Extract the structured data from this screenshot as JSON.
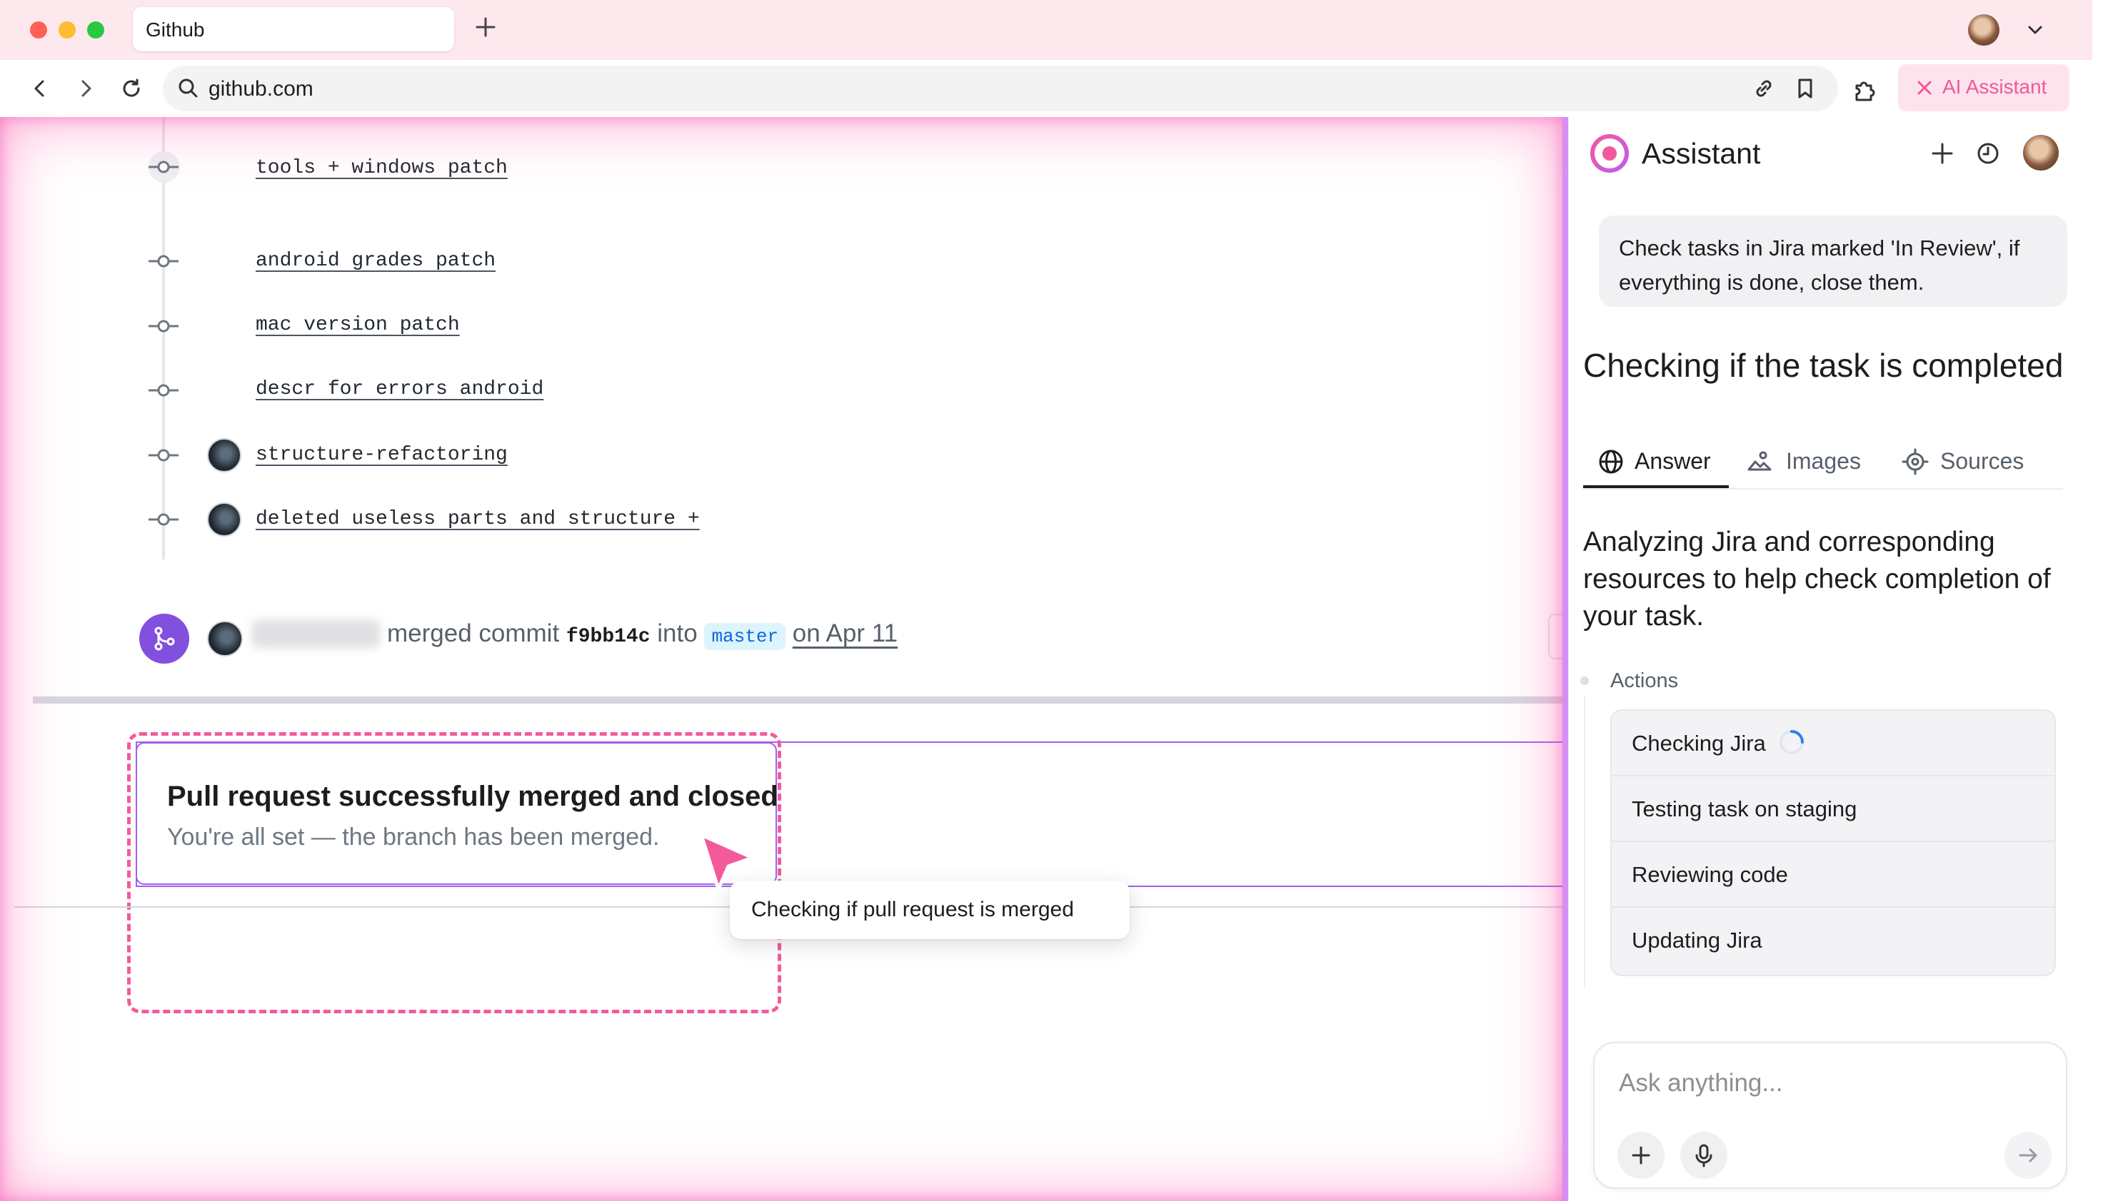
{
  "browser": {
    "tab_title": "Github",
    "url": "github.com",
    "ai_button_label": "AI Assistant"
  },
  "commits": [
    {
      "label": "tools + windows patch",
      "has_avatar": false
    },
    {
      "label": "android grades patch",
      "has_avatar": false
    },
    {
      "label": "mac version patch",
      "has_avatar": false
    },
    {
      "label": "descr for errors android",
      "has_avatar": false
    },
    {
      "label": "structure-refactoring",
      "has_avatar": true
    },
    {
      "label": "deleted useless parts and structure +",
      "has_avatar": true
    }
  ],
  "merge_event": {
    "text_merged": "merged commit",
    "sha": "f9bb14c",
    "text_into": "into",
    "branch": "master",
    "date": "on Apr 11"
  },
  "status_card": {
    "title": "Pull request successfully merged and closed",
    "subtitle": "You're all set — the branch has been merged."
  },
  "tooltip": {
    "text": "Checking if pull request is merged"
  },
  "assistant": {
    "title": "Assistant",
    "prompt": "Check  tasks in Jira marked 'In Review', if everything is done, close them.",
    "heading": "Checking if the task is completed",
    "tabs": [
      {
        "label": "Answer",
        "icon": "globe-icon",
        "active": true
      },
      {
        "label": "Images",
        "icon": "images-icon",
        "active": false
      },
      {
        "label": "Sources",
        "icon": "target-icon",
        "active": false
      }
    ],
    "answer": "Analyzing Jira and corresponding resources to help check completion of your task.",
    "actions_label": "Actions",
    "actions": [
      {
        "label": "Checking Jira",
        "in_progress": true
      },
      {
        "label": "Testing task on staging",
        "in_progress": false
      },
      {
        "label": "Reviewing code",
        "in_progress": false
      },
      {
        "label": "Updating Jira",
        "in_progress": false
      }
    ],
    "composer_placeholder": "Ask anything..."
  },
  "colors": {
    "accent_pink": "#f1589a",
    "merge_purple": "#8250df",
    "card_border": "#a25ff0",
    "spinner_blue": "#2f80ed"
  }
}
